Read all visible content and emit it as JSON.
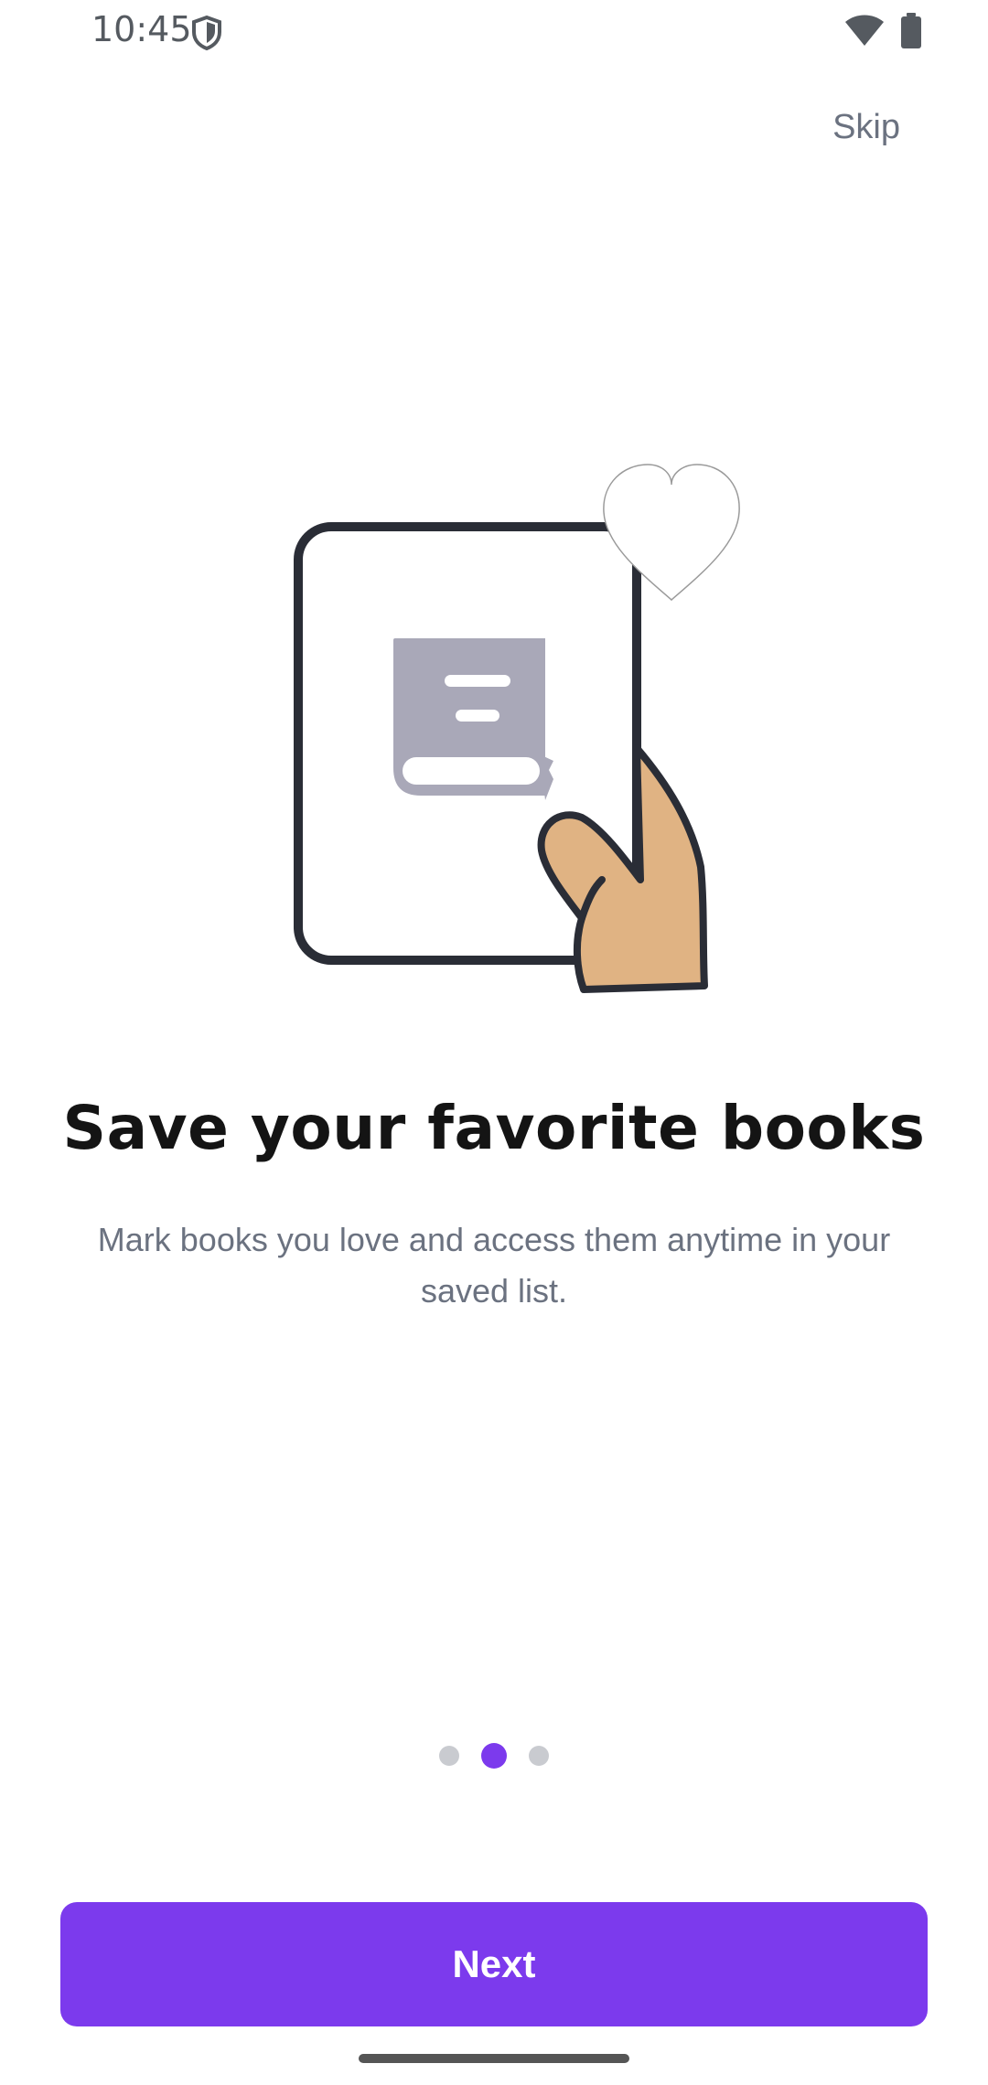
{
  "status_bar": {
    "time": "10:45",
    "icons": [
      "shield-icon",
      "wifi-icon",
      "battery-icon"
    ]
  },
  "header": {
    "skip_label": "Skip"
  },
  "illustration": {
    "description_icon": "hand-holding-book-with-heart-icon",
    "colors": {
      "outline": "#2a2d36",
      "book": "#a9a8b8",
      "hand": "#e0b383"
    }
  },
  "content": {
    "title": "Save your favorite books",
    "subtitle": "Mark books you love and access them anytime in your saved list."
  },
  "pager": {
    "total": 3,
    "active_index": 1
  },
  "footer": {
    "next_label": "Next"
  },
  "colors": {
    "accent": "#7c3aed",
    "title": "#141414",
    "muted_text": "#6b7280",
    "inactive_dot": "#c9cbd0"
  }
}
